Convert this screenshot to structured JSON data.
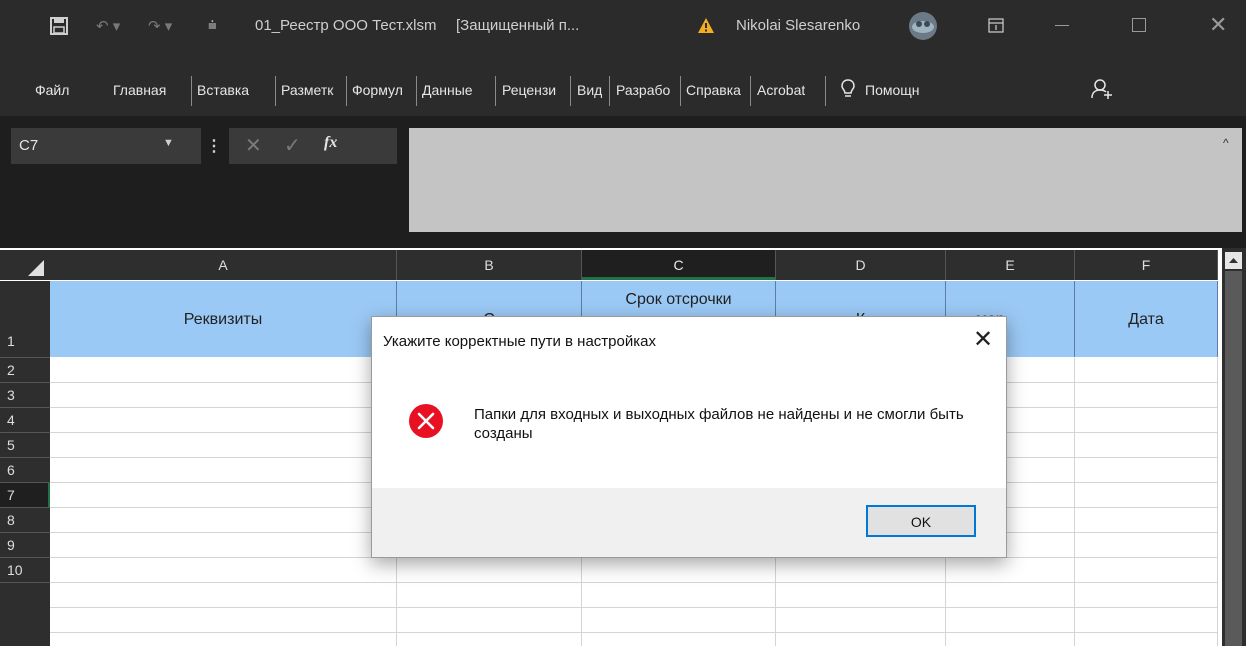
{
  "titlebar": {
    "filename": "01_Реестр ООО Тест.xlsm",
    "protected": "[Защищенный п...",
    "user": "Nikolai Slesarenko"
  },
  "ribbon": {
    "tabs": [
      "Файл",
      "Главная",
      "Вставка",
      "Разметк",
      "Формул",
      "Данные",
      "Рецензи",
      "Вид",
      "Разрабо",
      "Справка",
      "Acrobat",
      "Помощн"
    ]
  },
  "formula": {
    "cell_ref": "C7",
    "fx_label": "fx",
    "value": ""
  },
  "columns": [
    "A",
    "B",
    "C",
    "D",
    "E",
    "F"
  ],
  "selected_column": "C",
  "rows": [
    "1",
    "2",
    "3",
    "4",
    "5",
    "6",
    "7",
    "8",
    "9",
    "10"
  ],
  "selected_row": "7",
  "header_row": {
    "A": "Реквизиты",
    "B": "С",
    "C": "Срок отсрочки",
    "D": "К",
    "E": "мер",
    "F": "Дата"
  },
  "dialog": {
    "title": "Укажите корректные пути в настройках",
    "message": "Папки для входных и выходных файлов не найдены и не смогли быть созданы",
    "ok_label": "OK",
    "icon": "error-icon"
  },
  "colors": {
    "accent": "#217346",
    "header_fill": "#9bc9f5",
    "error": "#e81123",
    "focus": "#0078d7"
  }
}
